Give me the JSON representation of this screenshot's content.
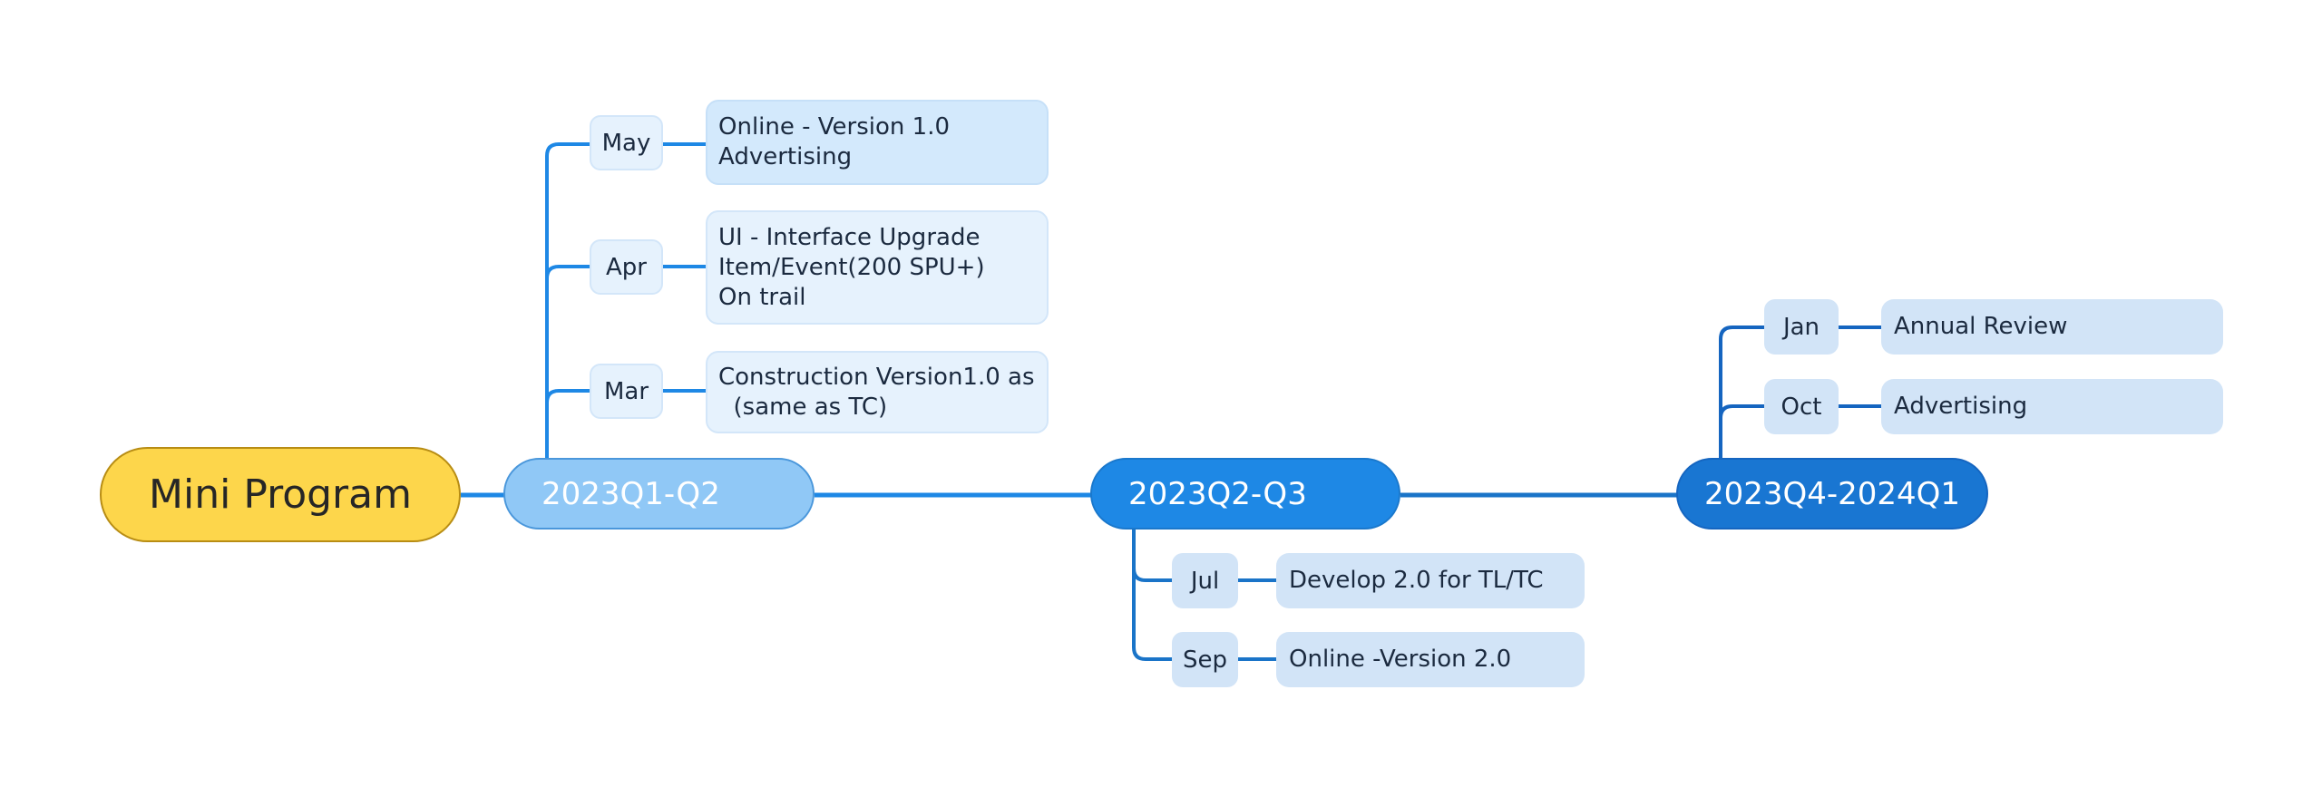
{
  "root": {
    "label": "Mini Program",
    "color": "#fdd64b"
  },
  "branches": [
    {
      "label": "2023Q1-Q2",
      "color": "#90c8f6",
      "items": [
        {
          "month": "May",
          "detail": "Online - Version 1.0\nAdvertising"
        },
        {
          "month": "Apr",
          "detail": "UI - Interface Upgrade\nItem/Event(200 SPU+)\nOn trail"
        },
        {
          "month": "Mar",
          "detail": "Construction Version1.0 as\n  (same as TC)"
        }
      ]
    },
    {
      "label": "2023Q2-Q3",
      "color": "#1e88e5",
      "items": [
        {
          "month": "Jul",
          "detail": "Develop 2.0 for TL/TC"
        },
        {
          "month": "Sep",
          "detail": "Online -Version 2.0"
        }
      ]
    },
    {
      "label": "2023Q4-2024Q1",
      "color": "#1976d2",
      "items": [
        {
          "month": "Jan",
          "detail": "Annual Review"
        },
        {
          "month": "Oct",
          "detail": "Advertising"
        }
      ]
    }
  ],
  "connector_color": "#1e88e5"
}
